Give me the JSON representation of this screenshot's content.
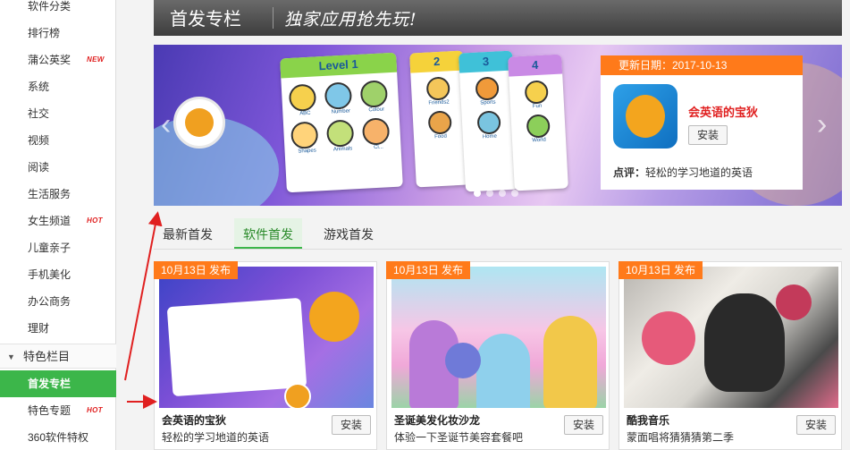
{
  "sidebar": {
    "items": [
      {
        "label": "软件分类",
        "badge": ""
      },
      {
        "label": "排行榜",
        "badge": ""
      },
      {
        "label": "蒲公英奖",
        "badge": "NEW"
      },
      {
        "label": "系统",
        "badge": ""
      },
      {
        "label": "社交",
        "badge": ""
      },
      {
        "label": "视频",
        "badge": ""
      },
      {
        "label": "阅读",
        "badge": ""
      },
      {
        "label": "生活服务",
        "badge": ""
      },
      {
        "label": "女生频道",
        "badge": "HOT"
      },
      {
        "label": "儿童亲子",
        "badge": ""
      },
      {
        "label": "手机美化",
        "badge": ""
      },
      {
        "label": "办公商务",
        "badge": ""
      },
      {
        "label": "理财",
        "badge": ""
      }
    ],
    "section_label": "特色栏目",
    "section_items": [
      {
        "label": "首发专栏",
        "badge": "",
        "active": true
      },
      {
        "label": "特色专题",
        "badge": "HOT"
      },
      {
        "label": "360软件特权",
        "badge": ""
      }
    ]
  },
  "header": {
    "title": "首发专栏",
    "slogan": "独家应用抢先玩!"
  },
  "hero": {
    "cards": {
      "level_label": "Level 1",
      "level_items": [
        "ABC",
        "Number",
        "Colour",
        "Shapes",
        "Animals",
        "Cl..."
      ],
      "c2_num": "2",
      "c2_items": [
        "Friends2",
        "Food"
      ],
      "c3_num": "3",
      "c3_items": [
        "Sports",
        "Home"
      ],
      "c4_num": "4",
      "c4_items": [
        "Fun",
        "World"
      ]
    },
    "pager_count": 4,
    "info": {
      "date_label": "更新日期：2017-10-13",
      "app_name": "会英语的宝狄",
      "install_label": "安装",
      "comment_prefix": "点评：",
      "comment_text": "轻松的学习地道的英语"
    }
  },
  "tabs": [
    {
      "label": "最新首发",
      "active": false
    },
    {
      "label": "软件首发",
      "active": true
    },
    {
      "label": "游戏首发",
      "active": false
    }
  ],
  "tiles": [
    {
      "tag": "10月13日 发布",
      "name": "会英语的宝狄",
      "desc": "轻松的学习地道的英语",
      "install": "安装"
    },
    {
      "tag": "10月13日 发布",
      "name": "圣诞美发化妆沙龙",
      "desc": "体验一下圣诞节美容套餐吧",
      "install": "安装"
    },
    {
      "tag": "10月13日 发布",
      "name": "酷我音乐",
      "desc": "蒙面唱将猜猜猜第二季",
      "install": "安装"
    }
  ],
  "colors": {
    "accent_green": "#3cb64a",
    "accent_orange": "#ff7a1a",
    "badge_red": "#e02020"
  }
}
